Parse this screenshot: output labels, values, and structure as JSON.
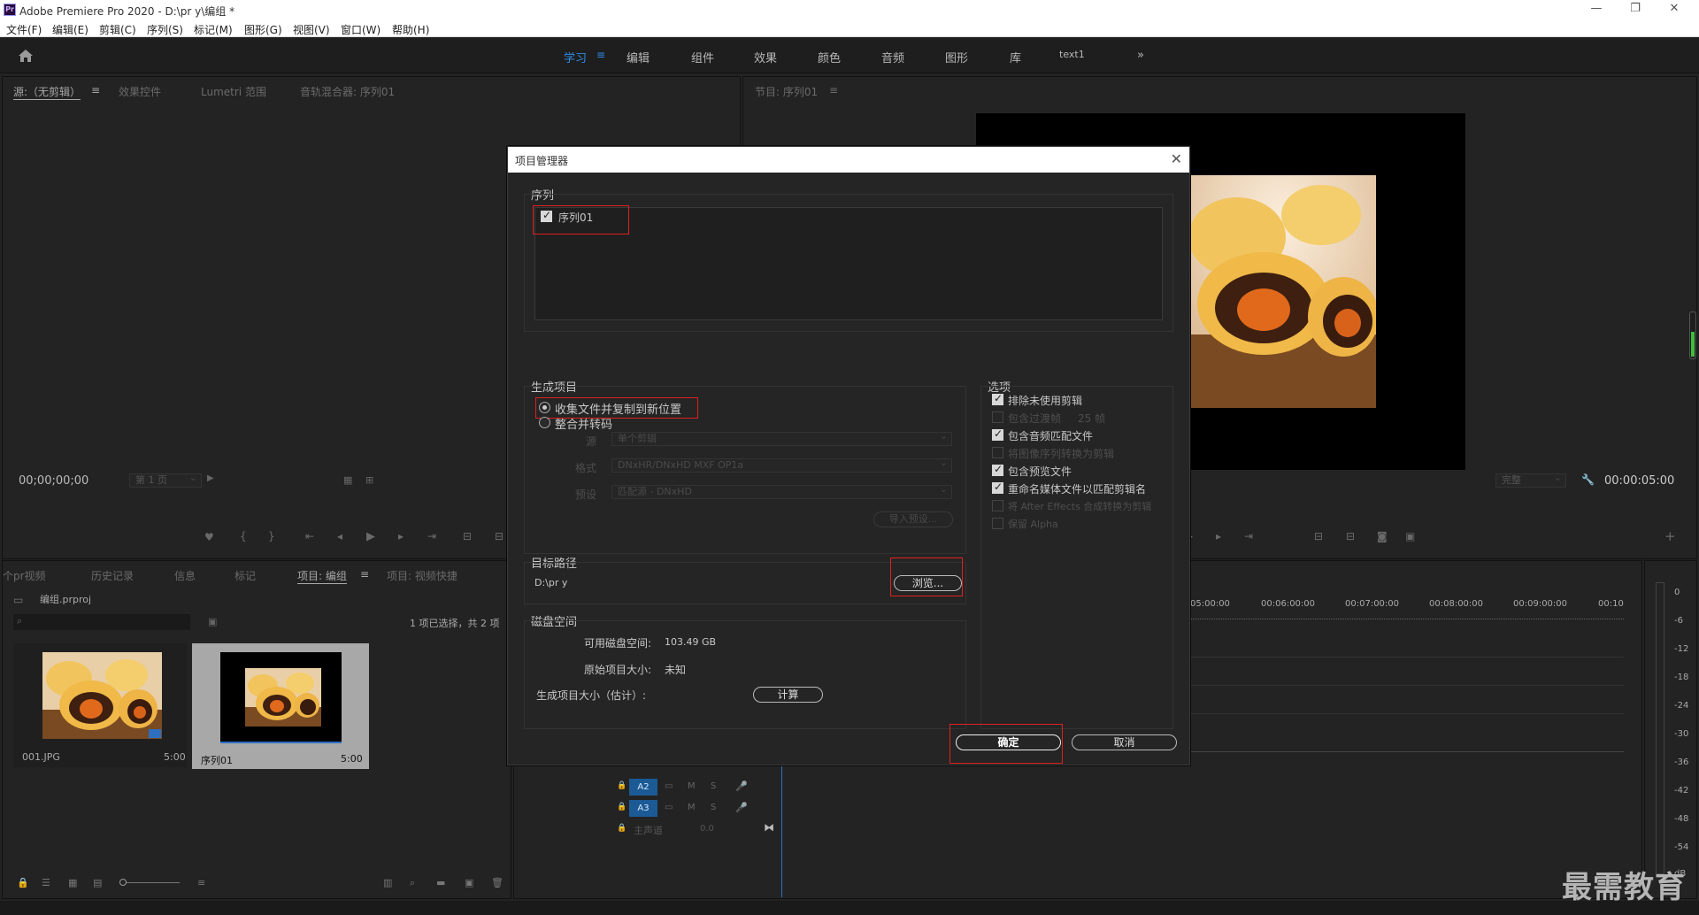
{
  "window": {
    "title": "Adobe Premiere Pro 2020 - D:\\pr y\\编组 *",
    "minimize": "—",
    "maximize": "❐",
    "close": "✕"
  },
  "menu": [
    "文件(F)",
    "编辑(E)",
    "剪辑(C)",
    "序列(S)",
    "标记(M)",
    "图形(G)",
    "视图(V)",
    "窗口(W)",
    "帮助(H)"
  ],
  "workspaces": {
    "tabs": [
      "学习",
      "编辑",
      "组件",
      "效果",
      "颜色",
      "音频",
      "图形",
      "库",
      "text1"
    ],
    "active": "学习",
    "more": "»"
  },
  "source_panel": {
    "tabs": [
      "源:（无剪辑）",
      "效果控件",
      "Lumetri 范围",
      "音轨混合器: 序列01"
    ],
    "timecode": "00;00;00;00",
    "page": "第 1 页"
  },
  "program_panel": {
    "tab": "节目: 序列01",
    "quality": "完整",
    "timecode": "00:00:05:00"
  },
  "project_panel": {
    "tabs": [
      "个pr视频",
      "历史记录",
      "信息",
      "标记",
      "项目: 编组",
      "项目: 视频快捷"
    ],
    "file": "编组.prproj",
    "selection_info": "1 项已选择，共 2 项",
    "items": [
      {
        "name": "001.JPG",
        "duration": "5:00"
      },
      {
        "name": "序列01",
        "duration": "5:00"
      }
    ]
  },
  "timeline": {
    "timecodes": [
      "05:00:00",
      "00:06:00:00",
      "00:07:00:00",
      "00:08:00:00",
      "00:09:00:00",
      "00:10"
    ],
    "tracks": [
      "A2",
      "A3"
    ],
    "master": "主声道",
    "master_value": "0.0",
    "track_buttons": [
      "M",
      "S"
    ]
  },
  "meter": {
    "labels": [
      "0",
      "-6",
      "-12",
      "-18",
      "-24",
      "-30",
      "-36",
      "-42",
      "-48",
      "-54"
    ],
    "unit": "dB"
  },
  "dialog": {
    "title": "项目管理器",
    "sequence_group": "序列",
    "sequences": [
      {
        "name": "序列01",
        "checked": true
      }
    ],
    "result_group": "生成项目",
    "result_options": [
      {
        "label": "收集文件并复制到新位置",
        "selected": true
      },
      {
        "label": "整合并转码",
        "selected": false
      }
    ],
    "transcode": {
      "source_label": "源",
      "source_value": "单个剪辑",
      "format_label": "格式",
      "format_value": "DNxHR/DNxHD MXF OP1a",
      "preset_label": "预设",
      "preset_value": "匹配源 - DNxHD",
      "import_preset": "导入预设..."
    },
    "options_group": "选项",
    "options": [
      {
        "label": "排除未使用剪辑",
        "checked": true,
        "enabled": true
      },
      {
        "label": "包含过渡帧",
        "suffix": "25 帧",
        "checked": false,
        "enabled": false
      },
      {
        "label": "包含音频匹配文件",
        "checked": true,
        "enabled": true
      },
      {
        "label": "将图像序列转换为剪辑",
        "checked": false,
        "enabled": false
      },
      {
        "label": "包含预览文件",
        "checked": true,
        "enabled": true
      },
      {
        "label": "重命名媒体文件以匹配剪辑名",
        "checked": true,
        "enabled": true
      },
      {
        "label": "将 After Effects 合成转换为剪辑",
        "checked": false,
        "enabled": false
      },
      {
        "label": "保留 Alpha",
        "checked": false,
        "enabled": false
      }
    ],
    "dest_group": "目标路径",
    "dest_path": "D:\\pr y",
    "browse": "浏览...",
    "disk_group": "磁盘空间",
    "disk_available_label": "可用磁盘空间:",
    "disk_available": "103.49 GB",
    "orig_size_label": "原始项目大小:",
    "orig_size": "未知",
    "result_size_label": "生成项目大小（估计）:",
    "calc": "计算",
    "ok": "确定",
    "cancel": "取消"
  },
  "watermark": "最需教育"
}
